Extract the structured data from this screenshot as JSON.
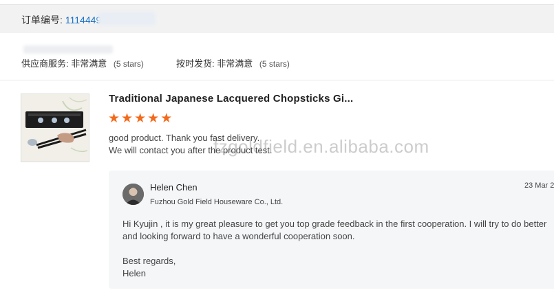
{
  "order": {
    "label": "订单编号:",
    "number": "1114449"
  },
  "ratings": {
    "supplier_service": {
      "label": "供应商服务:",
      "value": "非常满意",
      "stars": "(5 stars)"
    },
    "on_time_delivery": {
      "label": "按时发货:",
      "value": "非常满意",
      "stars": "(5 stars)"
    }
  },
  "product": {
    "title": "Traditional Japanese Lacquered Chopsticks Gi...",
    "rating": 5,
    "review_line1": "good product. Thank you fast delivery.",
    "review_line2": "We will contact you after the product test."
  },
  "watermark": "fzgoldfield.en.alibaba.com",
  "reply": {
    "seller_name": "Helen Chen",
    "company": "Fuzhou Gold Field Houseware Co., Ltd.",
    "date": "23 Mar 2",
    "message": "Hi  Kyujin , it is my great pleasure to get you top grade feedback in the first cooperation. I will try to do better and looking forward to have a wonderful cooperation soon.",
    "sign_line1": "Best regards,",
    "sign_line2": "Helen"
  },
  "colors": {
    "star": "#f26a1b",
    "link": "#1a73c9",
    "reply_bg": "#f5f6f8"
  }
}
